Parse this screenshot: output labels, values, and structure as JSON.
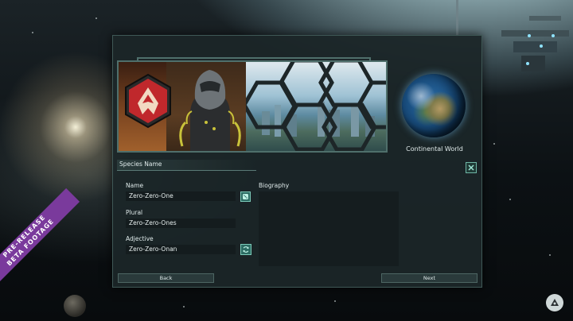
{
  "planet": {
    "label": "Continental World"
  },
  "form": {
    "section_title": "Species Name",
    "name_label": "Name",
    "name_value": "Zero-Zero-One",
    "plural_label": "Plural",
    "plural_value": "Zero-Zero-Ones",
    "adjective_label": "Adjective",
    "adjective_value": "Zero-Zero-Onan",
    "biography_label": "Biography",
    "biography_value": ""
  },
  "buttons": {
    "back": "Back",
    "next": "Next"
  },
  "banner": {
    "line1": "PRE-RELEASE",
    "line2": "BETA FOOTAGE"
  },
  "icons": {
    "close": "close-icon",
    "dice": "dice-icon",
    "refresh": "refresh-icon",
    "logo": "studio-logo-icon"
  },
  "colors": {
    "accent": "#6fb6a6",
    "panel": "#1b2628",
    "emblem": "#c0282c",
    "banner": "#7a3a9c"
  }
}
